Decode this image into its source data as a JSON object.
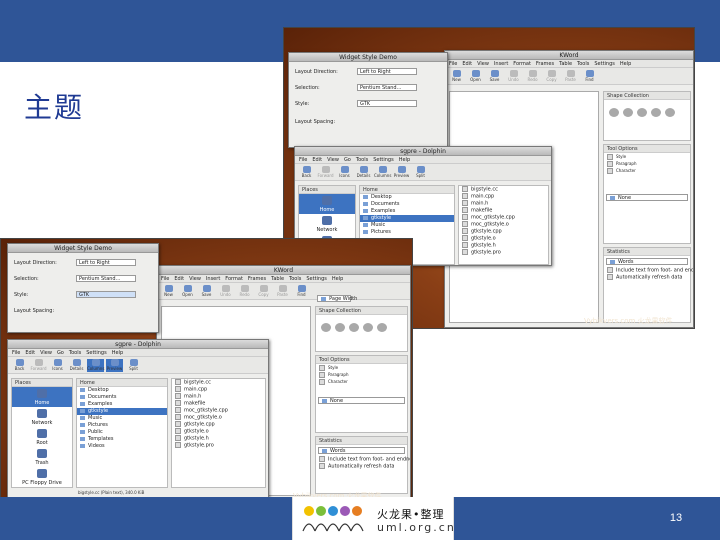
{
  "slide": {
    "title": "主题",
    "page_number": "13",
    "colors": {
      "bar": "#2f5597",
      "title": "#1f3a93"
    }
  },
  "logo": {
    "cn": "火龙果•整理",
    "en": "uml.org.cn"
  },
  "shot1": {
    "dialog_title": "Widget Style Demo",
    "dialog_fields": [
      {
        "label": "Layout Direction:",
        "value": "Left to Right"
      },
      {
        "label": "Selection:",
        "value": "Pentium Stand..."
      },
      {
        "label": "Style:",
        "value": "GTK"
      },
      {
        "label": "Layout Spacing:",
        "value": ""
      }
    ],
    "kword": {
      "title": "KWord",
      "menu": [
        "File",
        "Edit",
        "View",
        "Insert",
        "Format",
        "Frames",
        "Table",
        "Tools",
        "Settings",
        "Help"
      ],
      "toolbar": [
        "New",
        "Open",
        "Save",
        "Undo",
        "Redo",
        "Copy",
        "Paste",
        "Find"
      ],
      "shape_collection": "Shape Collection",
      "tool_options": "Tool Options",
      "tabs": [
        "Style",
        "Paragraph",
        "Character"
      ],
      "style_value": "None",
      "statistics": "Statistics",
      "stats_value": "Words",
      "options": [
        "Include text from foot- and endnotes",
        "Automatically refresh data"
      ]
    },
    "dolphin": {
      "title": "sgpre - Dolphin",
      "menu": [
        "File",
        "Edit",
        "View",
        "Go",
        "Tools",
        "Settings",
        "Help"
      ],
      "toolbar": [
        "Back",
        "Forward",
        "Icons",
        "Details",
        "Columns",
        "Preview",
        "Split"
      ],
      "places_header": "Places",
      "places": [
        "Home",
        "Network",
        "Root",
        "Trash"
      ],
      "folder_header": "Home",
      "folders": [
        "Desktop",
        "Documents",
        "Examples",
        "gtkstyle",
        "Music",
        "Pictures"
      ],
      "files": [
        "bigstyle.cc",
        "main.cpp",
        "main.h",
        "makefile",
        "moc_gtkstyle.cpp",
        "moc_gtkstyle.o",
        "gtkstyle.cpp",
        "gtkstyle.o",
        "gtkstyle.h",
        "gtkstyle.pro"
      ]
    },
    "watermark": "Vybikvers.com 火龙果软件"
  },
  "shot2": {
    "dialog_title": "Widget Style Demo",
    "dialog_fields": [
      {
        "label": "Layout Direction:",
        "value": "Left to Right"
      },
      {
        "label": "Selection:",
        "value": "Pentium Stand..."
      },
      {
        "label": "Style:",
        "value": "GTK"
      },
      {
        "label": "Layout Spacing:",
        "value": ""
      }
    ],
    "kword": {
      "title": "KWord",
      "menu": [
        "File",
        "Edit",
        "View",
        "Insert",
        "Format",
        "Frames",
        "Table",
        "Tools",
        "Settings",
        "Help"
      ],
      "toolbar": [
        "New",
        "Open",
        "Save",
        "Undo",
        "Redo",
        "Copy",
        "Paste",
        "Find"
      ],
      "zoom": "Page Width",
      "shape_collection": "Shape Collection",
      "tool_options": "Tool Options",
      "tabs": [
        "Style",
        "Paragraph",
        "Character"
      ],
      "style_value": "None",
      "statistics": "Statistics",
      "stats_value": "Words",
      "options": [
        "Include text from foot- and endnotes",
        "Automatically refresh data"
      ]
    },
    "dolphin": {
      "title": "sgpre - Dolphin",
      "menu": [
        "File",
        "Edit",
        "View",
        "Go",
        "Tools",
        "Settings",
        "Help"
      ],
      "toolbar": [
        "Back",
        "Forward",
        "Icons",
        "Details",
        "Columns",
        "Preview",
        "Split"
      ],
      "places_header": "Places",
      "places": [
        "Home",
        "Network",
        "Root",
        "Trash",
        "PC Floppy Drive"
      ],
      "folder_header": "Home",
      "folders": [
        "Desktop",
        "Documents",
        "Examples",
        "gtkstyle",
        "Music",
        "Pictures",
        "Public",
        "Templates",
        "Videos"
      ],
      "files": [
        "bigstyle.cc",
        "main.cpp",
        "main.h",
        "makefile",
        "moc_gtkstyle.cpp",
        "moc_gtkstyle.o",
        "gtkstyle.cpp",
        "gtkstyle.o",
        "gtkstyle.h",
        "gtkstyle.pro"
      ],
      "status": "bigstyle.cc (Plain text), 340.0 KiB"
    },
    "watermark": "Vybikvers.com 火龙果软件"
  }
}
